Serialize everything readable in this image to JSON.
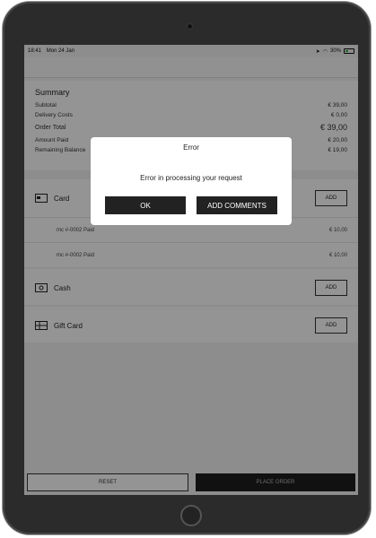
{
  "status_bar": {
    "time": "18:41",
    "date": "Mon 24 Jan",
    "battery": "30%"
  },
  "summary": {
    "title": "Summary",
    "rows": [
      {
        "label": "Subtotal",
        "value": "€ 39,00"
      },
      {
        "label": "Delivery Costs",
        "value": "€ 0,00"
      },
      {
        "label": "Order Total",
        "value": "€ 39,00"
      },
      {
        "label": "Amount Paid",
        "value": "€ 20,00"
      },
      {
        "label": "Remaining Balance",
        "value": "€ 19,00"
      }
    ]
  },
  "payments": {
    "add_label": "ADD",
    "card": {
      "title": "Card",
      "entries": [
        {
          "label": "mc #-0002 Paid",
          "value": "€ 10,00"
        },
        {
          "label": "mc #-0002 Paid",
          "value": "€ 10,00"
        }
      ]
    },
    "cash": {
      "title": "Cash"
    },
    "gift_card": {
      "title": "Gift Card"
    }
  },
  "footer": {
    "reset_label": "RESET",
    "place_order_label": "PLACE ORDER"
  },
  "dialog": {
    "title": "Error",
    "message": "Error in processing your request",
    "ok_label": "OK",
    "comments_label": "ADD COMMENTS"
  }
}
